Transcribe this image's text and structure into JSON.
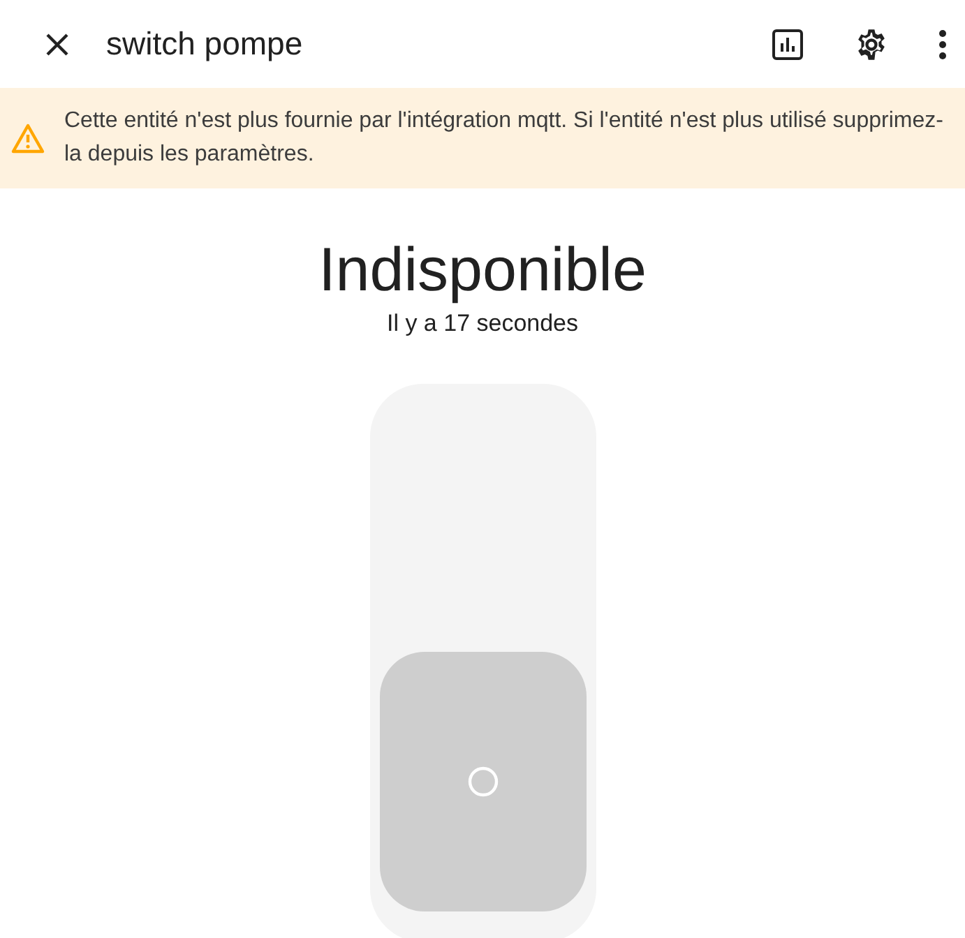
{
  "dialog": {
    "title": "switch pompe"
  },
  "warning": {
    "text": "Cette entité n'est plus fournie par l'intégration mqtt. Si l'entité n'est plus utilisé supprimez-la depuis les paramètres."
  },
  "state": {
    "label": "Indisponible",
    "time": "Il y a 17 secondes"
  },
  "switch": {
    "on": false,
    "available": false
  }
}
